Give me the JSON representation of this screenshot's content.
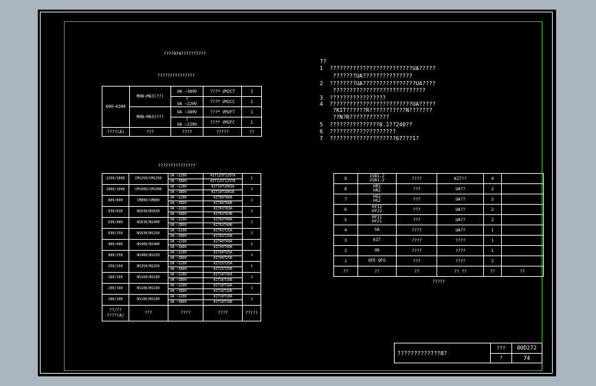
{
  "table1": {
    "title": "??7?974??7???7???",
    "subtitle": "???????????????",
    "range": "600~6300",
    "groups": [
      {
        "model": "M0B~M63(??)",
        "rows": [
          {
            "ua": "UA  ~380V",
            "mid": "",
            "code": "???*  VM2CT",
            "qty": "1"
          },
          {
            "ua": "UA  ~220V",
            "mid": "?",
            "code": "???*  VM2CC",
            "qty": "1"
          }
        ]
      },
      {
        "model": "M0B~M63(??)",
        "rows": [
          {
            "ua": "UA  ~380V",
            "mid": "",
            "code": "???*  VM2FT",
            "qty": "1"
          },
          {
            "ua": "UA  ~220V",
            "mid": "?",
            "code": "???*  VM2FC",
            "qty": "1"
          }
        ]
      }
    ],
    "footer": [
      "????(A)",
      "???",
      "????",
      "?????",
      "??"
    ]
  },
  "table2": {
    "title": "???????????????",
    "rows": [
      {
        "a": "1250/1000",
        "b": "CM1250/CM1250",
        "ua": [
          "UA   ~220V",
          "UA   ~380V"
        ],
        "kit": [
          "KIT125T125TA",
          "KIT125T125TB"
        ],
        "q": "1"
      },
      {
        "a": "1000/1000",
        "b": "CM1000/CM1000",
        "ua": [
          "UA   ~220V",
          "UA   ~380V"
        ],
        "kit": [
          "KIT10T1001A",
          "KIT10T1001B"
        ],
        "q": "1"
      },
      {
        "a": "800/800",
        "b": "CM800/CM800",
        "ua": [
          "UA   ~220V",
          "UA   ~380V"
        ],
        "kit": [
          "KIT80T80A",
          "KIT80T80B"
        ],
        "q": "1"
      },
      {
        "a": "630/630",
        "b": "NS630/NS630",
        "ua": [
          "UA   ~220V",
          "UA   ~380V"
        ],
        "kit": [
          "KIT63T63A",
          "KIT63T63B"
        ],
        "q": "1"
      },
      {
        "a": "630/400",
        "b": "NS630/NS400",
        "ua": [
          "UA   ~220V",
          "UA   ~380V"
        ],
        "kit": [
          "KIT63T40A",
          "KIT63T40B"
        ],
        "q": "1"
      },
      {
        "a": "630/250",
        "b": "NS630/NS250",
        "ua": [
          "UA   ~220V",
          "UA   ~380V"
        ],
        "kit": [
          "KIT63T25A",
          "KIT63T25B"
        ],
        "q": "1"
      },
      {
        "a": "400/400",
        "b": "NS400/NS400",
        "ua": [
          "UA   ~220V",
          "UA   ~380V"
        ],
        "kit": [
          "KIT40T40A",
          "KIT40T40B"
        ],
        "q": "1"
      },
      {
        "a": "400/250",
        "b": "NS400/NS250",
        "ua": [
          "UA   ~220V",
          "UA   ~380V"
        ],
        "kit": [
          "KIT40T25A",
          "KIT40T25B"
        ],
        "q": "1"
      },
      {
        "a": "250/250",
        "b": "NS250/NS250",
        "ua": [
          "UA   ~220V",
          "UA   ~380V"
        ],
        "kit": [
          "KIT25T25A",
          "KIT25T25B"
        ],
        "q": "1"
      },
      {
        "a": "160/160",
        "b": "NS160/NS160",
        "ua": [
          "UA   ~220V",
          "UA   ~380V"
        ],
        "kit": [
          "KIT16T16A",
          "KIT16T16B"
        ],
        "q": "1"
      },
      {
        "a": "100/160",
        "b": "NS100/NS160",
        "ua": [
          "UA   ~220V",
          "UA   ~380V"
        ],
        "kit": [
          "KIT10T16A",
          "KIT10T16B"
        ],
        "q": "1"
      },
      {
        "a": "100/100",
        "b": "NS100/NS100",
        "ua": [
          "UA   ~220V",
          "UA   ~380V"
        ],
        "kit": [
          "KIT10T10A",
          "KIT10T10B"
        ],
        "q": "1"
      }
    ],
    "footer": [
      "??/??\n????(A)",
      "???",
      "????",
      "????",
      "??(?)"
    ]
  },
  "notes": {
    "heading": "??",
    "lines": [
      "1  ?????????????????????????UA?????",
      "    ???????UA???????????????",
      "2  ????????UA????????????????UA????",
      "    ????????????????????????????",
      "3  ?????????????????",
      "4  ?????????????????????????UA?????",
      "    ?KIT??????R???????????N???????",
      "    ??N?R????????????",
      "5  ???????????????0.1??240??",
      "6  ????????????????????",
      "7  ????????????????????67???1?"
    ]
  },
  "table3": {
    "rows": [
      {
        "no": "9",
        "code": "1SB1.2\n2SB1.2",
        "name": "????",
        "spec": "KIT??",
        "qty": "4"
      },
      {
        "no": "8",
        "code": "HR1\nHR2",
        "name": "???",
        "spec": "UA??",
        "qty": "2"
      },
      {
        "no": "7",
        "code": "HG1\nHG2",
        "name": "???",
        "spec": "UA??",
        "qty": "2"
      },
      {
        "no": "6",
        "code": "HY12\nHY22",
        "name": "???",
        "spec": "UA??",
        "qty": "2"
      },
      {
        "no": "5",
        "code": "HY11\nHY21",
        "name": "???",
        "spec": "UA??",
        "qty": "2"
      },
      {
        "no": "4",
        "code": "SA",
        "name": "????",
        "spec": "UA??",
        "qty": "1"
      },
      {
        "no": "3",
        "code": "KIT",
        "name": "????",
        "spec": "????",
        "qty": "1"
      },
      {
        "no": "2",
        "code": "UA",
        "name": "????",
        "spec": "????",
        "qty": "1"
      },
      {
        "no": "1",
        "code": "QFE   QFG",
        "name": "???",
        "spec": "????",
        "qty": "2"
      }
    ],
    "header": [
      "??",
      "??",
      "??",
      "??   ??",
      "??",
      "??"
    ],
    "caption": "?????"
  },
  "titleblock": {
    "name": "?????????????8?",
    "label1": "???",
    "code": "00D272",
    "label2": "?",
    "page": "74"
  }
}
